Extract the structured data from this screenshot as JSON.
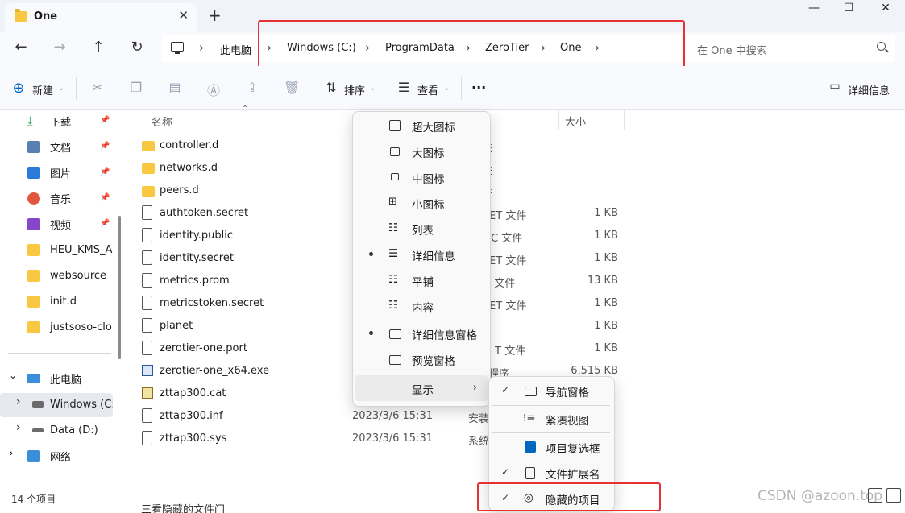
{
  "window": {
    "tab_title": "One",
    "close_tab": "✕",
    "new_tab": "+",
    "minimize": "—",
    "maximize": "☐",
    "close": "✕"
  },
  "nav": {
    "back": "←",
    "forward": "→",
    "up": "↑",
    "refresh": "↻"
  },
  "breadcrumb": [
    "此电脑",
    "Windows (C:)",
    "ProgramData",
    "ZeroTier",
    "One"
  ],
  "breadcrumb_sep": "›",
  "search": {
    "placeholder": "在 One 中搜索"
  },
  "toolbar": {
    "new_label": "新建",
    "sort_label": "排序",
    "view_label": "查看",
    "more_label": "···",
    "details_pane_label": "详细信息"
  },
  "sidebar": {
    "quick": [
      {
        "label": "下载",
        "color": "#2a9a57"
      },
      {
        "label": "文档",
        "color": "#5b7fb0"
      },
      {
        "label": "图片",
        "color": "#2b7bd8"
      },
      {
        "label": "音乐",
        "color": "#e0573d"
      },
      {
        "label": "视频",
        "color": "#8746c9"
      }
    ],
    "folders": [
      "HEU_KMS_Acti",
      "websource",
      "init.d",
      "justsoso-cloud"
    ],
    "tree": [
      {
        "label": "此电脑",
        "expander": "⌄"
      },
      {
        "label": "Windows (C:)",
        "expander": "›"
      },
      {
        "label": "Data (D:)",
        "expander": "›"
      },
      {
        "label": "网络",
        "expander": "›"
      }
    ]
  },
  "columns": {
    "name": "名称",
    "size": "大小"
  },
  "files": [
    {
      "name": "controller.d",
      "type_frag": "夹",
      "size": ""
    },
    {
      "name": "networks.d",
      "type_frag": "夹",
      "size": ""
    },
    {
      "name": "peers.d",
      "type_frag": "夹",
      "size": ""
    },
    {
      "name": "authtoken.secret",
      "type_frag": "RET 文件",
      "size": "1 KB"
    },
    {
      "name": "identity.public",
      "type_frag": "LIC 文件",
      "size": "1 KB"
    },
    {
      "name": "identity.secret",
      "type_frag": "RET 文件",
      "size": "1 KB"
    },
    {
      "name": "metrics.prom",
      "type_frag": "M 文件",
      "size": "13 KB"
    },
    {
      "name": "metricstoken.secret",
      "type_frag": "RET 文件",
      "size": "1 KB"
    },
    {
      "name": "planet",
      "type_frag": "",
      "size": "1 KB"
    },
    {
      "name": "zerotier-one.port",
      "type_frag": "T 文件",
      "size": "1 KB"
    },
    {
      "name": "zerotier-one_x64.exe",
      "type_frag": "程序",
      "size": "6,515 KB"
    },
    {
      "name": "zttap300.cat",
      "type_frag": "",
      "size": ""
    },
    {
      "name": "zttap300.inf",
      "date": "2023/3/6 15:31",
      "type_frag": "安装",
      "size": ""
    },
    {
      "name": "zttap300.sys",
      "date": "2023/3/6 15:31",
      "type_frag": "系统",
      "size": ""
    }
  ],
  "date_frags": [
    "2",
    "2",
    "2",
    "2",
    "2",
    "2",
    "2",
    "2",
    "2",
    "2",
    "2"
  ],
  "view_menu": [
    {
      "label": "超大图标",
      "selected": false
    },
    {
      "label": "大图标",
      "selected": false
    },
    {
      "label": "中图标",
      "selected": false
    },
    {
      "label": "小图标",
      "selected": false
    },
    {
      "label": "列表",
      "selected": false
    },
    {
      "label": "详细信息",
      "selected": true
    },
    {
      "label": "平铺",
      "selected": false
    },
    {
      "label": "内容",
      "selected": false
    },
    {
      "label": "详细信息窗格",
      "selected": true
    },
    {
      "label": "预览窗格",
      "selected": false
    },
    {
      "label": "显示",
      "selected": false
    }
  ],
  "show_submenu": [
    {
      "label": "导航窗格",
      "checked": true
    },
    {
      "label": "紧凑视图",
      "checked": false
    },
    {
      "label": "项目复选框",
      "checked": false
    },
    {
      "label": "文件扩展名",
      "checked": true
    },
    {
      "label": "隐藏的项目",
      "checked": true
    }
  ],
  "checkmark": "✓",
  "submenu_arrow": "›",
  "status": {
    "count": "14 个项目"
  },
  "bottom_text": "三看隐藏的文件门",
  "watermark": "CSDN @azoon.top",
  "colors": {
    "highlight": "#e63232",
    "folder": "#f8c843",
    "accent": "#0067c0"
  }
}
